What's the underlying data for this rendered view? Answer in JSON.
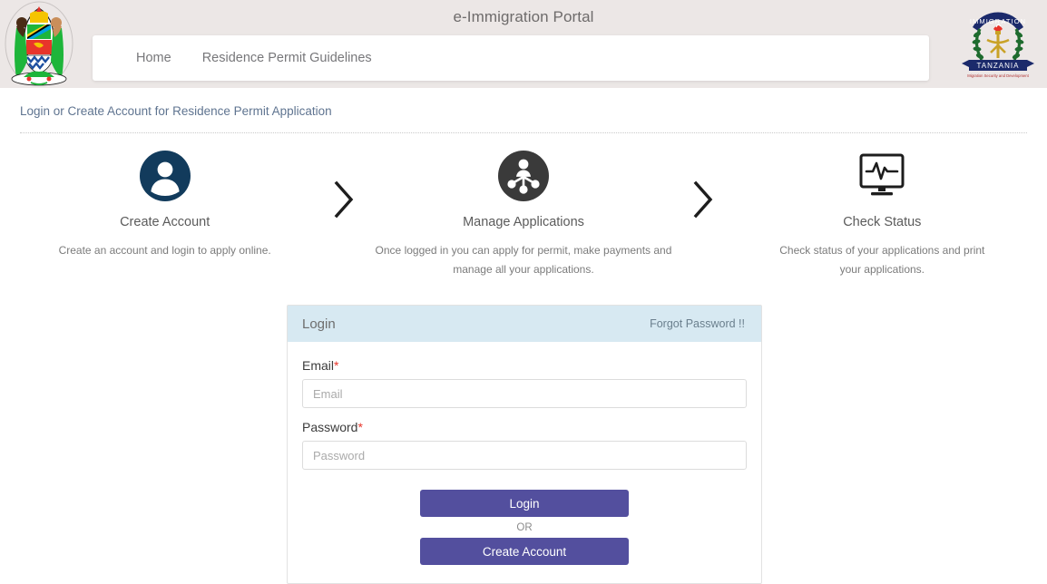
{
  "header": {
    "title": "e-Immigration Portal",
    "left_emblem_name": "tanzania-coat-of-arms",
    "right_emblem_name": "tanzania-immigration-emblem",
    "right_emblem_text": {
      "top": "IMMIGRATION",
      "ribbon": "TANZANIA",
      "motto": "Migration Security and Development"
    },
    "nav": [
      {
        "label": "Home"
      },
      {
        "label": "Residence Permit Guidelines"
      }
    ]
  },
  "breadcrumb": {
    "text": "Login or Create Account for Residence Permit Application"
  },
  "steps": [
    {
      "icon": "user-circle-icon",
      "title": "Create Account",
      "desc": "Create an account and login to apply online."
    },
    {
      "icon": "network-users-icon",
      "title": "Manage Applications",
      "desc": "Once logged in you can apply for permit, make payments and manage all your applications."
    },
    {
      "icon": "monitor-pulse-icon",
      "title": "Check Status",
      "desc": "Check status of your applications and print your applications."
    }
  ],
  "arrow_glyph": "chevron-right-icon",
  "login_card": {
    "title": "Login",
    "forgot_password": "Forgot Password !!",
    "email": {
      "label": "Email",
      "required_marker": "*",
      "placeholder": "Email",
      "value": ""
    },
    "password": {
      "label": "Password",
      "required_marker": "*",
      "placeholder": "Password",
      "value": ""
    },
    "login_button": "Login",
    "or_label": "OR",
    "create_account_button": "Create Account"
  },
  "colors": {
    "topbar_bg": "#ece7e6",
    "card_header_bg": "#d7e9f2",
    "button_purple": "#534f9e",
    "breadcrumb_text": "#5f7490",
    "required_red": "#e8352b",
    "step1_circle": "#123b5c",
    "step2_circle": "#3a3a3a"
  }
}
